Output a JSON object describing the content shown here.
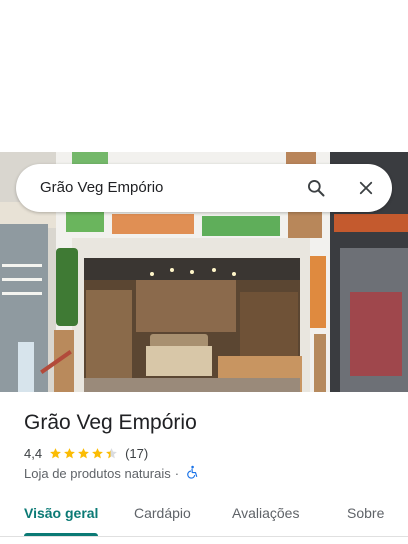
{
  "search": {
    "query": "Grão Veg Empório",
    "search_icon": "search-icon",
    "close_icon": "close-icon"
  },
  "photo": {
    "subject": "storefront-photo"
  },
  "place": {
    "name": "Grão Veg Empório",
    "rating": "4,4",
    "rating_value": 4.4,
    "star_count": 5,
    "review_count": "(17)",
    "category": "Loja de produtos naturais",
    "separator": "·",
    "accessibility_icon": "wheelchair-icon"
  },
  "tabs": [
    {
      "label": "Visão geral",
      "active": true
    },
    {
      "label": "Cardápio",
      "active": false
    },
    {
      "label": "Avaliações",
      "active": false
    },
    {
      "label": "Sobre",
      "active": false
    }
  ],
  "colors": {
    "accent": "#0b7a75",
    "star": "#fbbc04",
    "star_empty": "#dadce0",
    "text": "#202124",
    "secondary_text": "#5f6368",
    "access_icon": "#1a73e8"
  }
}
